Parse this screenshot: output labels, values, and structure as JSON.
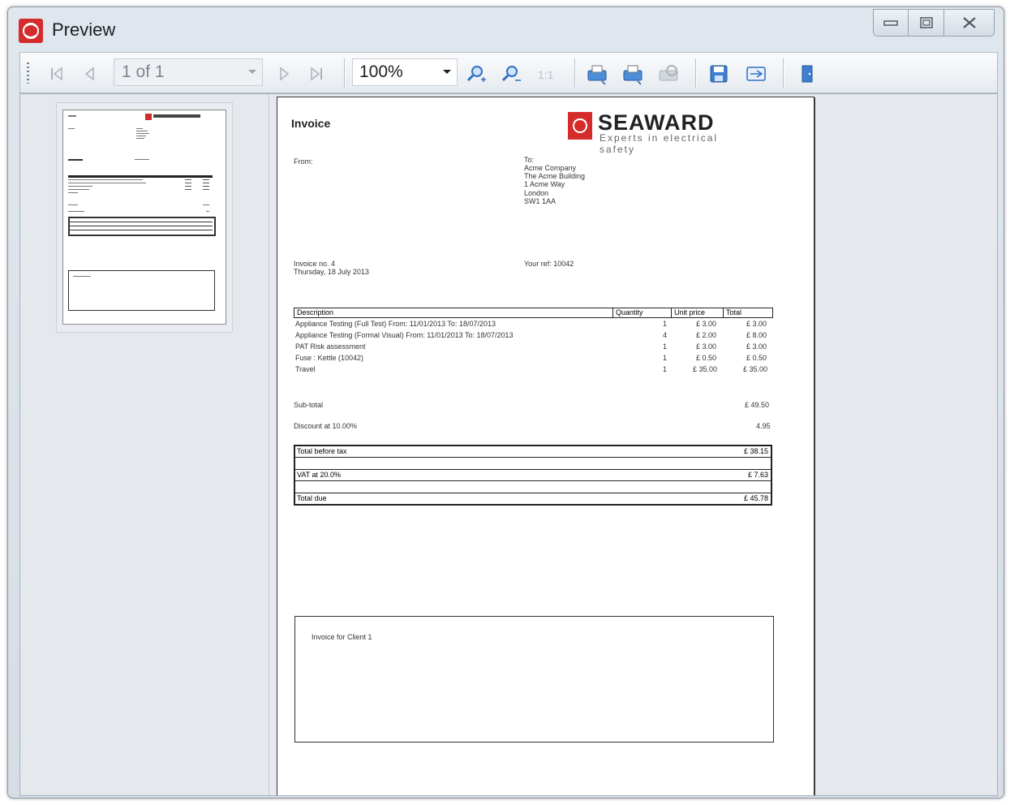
{
  "window": {
    "title": "Preview",
    "controls": [
      "minimize-icon",
      "restore-icon",
      "close-icon"
    ]
  },
  "toolbar": {
    "page_indicator": "1 of 1",
    "zoom": "100%",
    "buttons": [
      "first-page",
      "previous-page",
      "next-page",
      "last-page",
      "zoom-in",
      "zoom-out",
      "actual-size",
      "print",
      "print-quick",
      "page-setup",
      "save",
      "export",
      "exit"
    ]
  },
  "invoice": {
    "title": "Invoice",
    "logo_name": "SEAWARD",
    "logo_tagline": "Experts in electrical safety",
    "from_label": "From:",
    "to_label": "To:",
    "to_lines": [
      "Acme Company",
      "The Acme Building",
      "1 Acme Way",
      "London",
      "SW1 1AA"
    ],
    "invoice_no": "Invoice no. 4",
    "date": "Thursday, 18 July 2013",
    "your_ref": "Your ref: 10042",
    "columns": {
      "description": "Description",
      "quantity": "Quantity",
      "unit_price": "Unit price",
      "total": "Total"
    },
    "items": [
      {
        "description": "Appliance Testing (Full Test)  From: 11/01/2013  To: 18/07/2013",
        "quantity": "1",
        "unit_price": "£ 3.00",
        "total": "£ 3.00"
      },
      {
        "description": "Appliance Testing (Formal Visual)  From: 11/01/2013  To: 18/07/2013",
        "quantity": "4",
        "unit_price": "£ 2.00",
        "total": "£ 8.00"
      },
      {
        "description": "PAT Risk assessment",
        "quantity": "1",
        "unit_price": "£ 3.00",
        "total": "£ 3.00"
      },
      {
        "description": "Fuse : Kettle  (10042)",
        "quantity": "1",
        "unit_price": "£ 0.50",
        "total": "£ 0.50"
      },
      {
        "description": "Travel",
        "quantity": "1",
        "unit_price": "£ 35.00",
        "total": "£ 35.00"
      }
    ],
    "subtotal_label": "Sub-total",
    "subtotal_value": "£ 49.50",
    "discount_label": "Discount at 10.00%",
    "discount_value": "4.95",
    "total_before_tax_label": "Total before tax",
    "total_before_tax_value": "£ 38.15",
    "vat_label": "VAT at 20.0%",
    "vat_value": "£ 7.63",
    "total_due_label": "Total due",
    "total_due_value": "£ 45.78",
    "notes": "Invoice for Client 1"
  },
  "colors": {
    "brand_red": "#d42b2b",
    "toolbar_icon_blue": "#2f6fc1"
  }
}
